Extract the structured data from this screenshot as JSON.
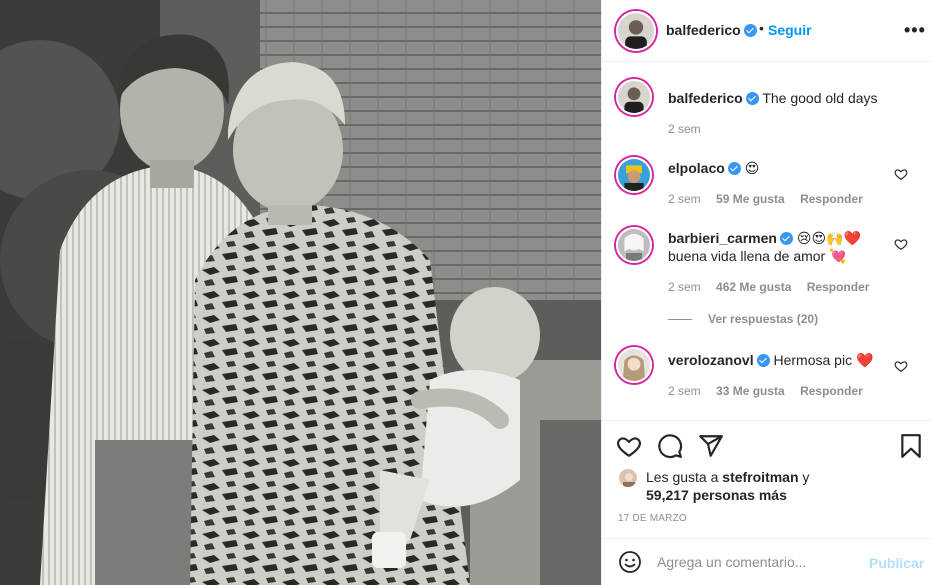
{
  "header": {
    "username": "balfederico",
    "separator": "•",
    "follow_label": "Seguir",
    "more_label": "•••"
  },
  "caption": {
    "username": "balfederico",
    "text": "The good old days",
    "time": "2 sem"
  },
  "comments": [
    {
      "username": "elpolaco",
      "text": "😍",
      "time": "2 sem",
      "likes": "59 Me gusta",
      "reply": "Responder"
    },
    {
      "username": "barbieri_carmen",
      "text": "😢😍🙌❤️",
      "text2": "buena vida llena de amor 💘",
      "time": "2 sem",
      "likes": "462 Me gusta",
      "reply": "Responder"
    },
    {
      "username": "verolozanovl",
      "text": "Hermosa pic ❤️",
      "time": "2 sem",
      "likes": "33 Me gusta",
      "reply": "Responder"
    }
  ],
  "view_replies": "Ver respuestas (20)",
  "likes": {
    "line1_prefix": "Les gusta a ",
    "line1_user": "stefroitman",
    "line1_suffix": " y",
    "line2": "59,217 personas más"
  },
  "date": "17 DE MARZO",
  "composer": {
    "placeholder": "Agrega un comentario...",
    "publish_label": "Publicar"
  },
  "colors": {
    "accent": "#0095f6",
    "verified": "#3897f0",
    "publish_disabled": "#b2dffc",
    "muted": "#8e8e8e",
    "text": "#262626"
  },
  "icons": [
    "heart-icon",
    "comment-icon",
    "share-icon",
    "bookmark-icon",
    "emoji-icon",
    "verified-icon",
    "more-icon"
  ]
}
